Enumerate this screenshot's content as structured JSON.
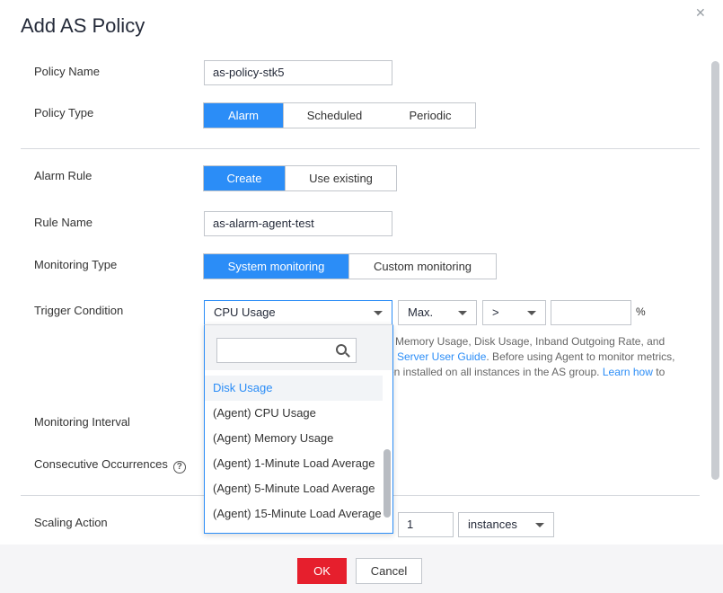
{
  "dialog": {
    "title": "Add AS Policy",
    "close_icon": "close-icon"
  },
  "policy_name": {
    "label": "Policy Name",
    "value": "as-policy-stk5"
  },
  "policy_type": {
    "label": "Policy Type",
    "options": [
      "Alarm",
      "Scheduled",
      "Periodic"
    ],
    "selected": "Alarm"
  },
  "alarm_rule": {
    "label": "Alarm Rule",
    "options": [
      "Create",
      "Use existing"
    ],
    "selected": "Create"
  },
  "rule_name": {
    "label": "Rule Name",
    "value": "as-alarm-agent-test"
  },
  "monitoring_type": {
    "label": "Monitoring Type",
    "options": [
      "System monitoring",
      "Custom monitoring"
    ],
    "selected": "System monitoring"
  },
  "trigger_condition": {
    "label": "Trigger Condition",
    "metric": "CPU Usage",
    "aggregation": "Max.",
    "operator": ">",
    "threshold": "",
    "unit": "%",
    "hint_line1": "Memory Usage, Disk Usage, Inband Outgoing Rate, and",
    "hint_line2_link": "d Server User Guide",
    "hint_line2_rest": ". Before using Agent to monitor metrics,",
    "hint_line3": "en installed on all instances in the AS group.",
    "hint_line3_link": "Learn how",
    "hint_line3_tail": "to"
  },
  "metric_dropdown": {
    "search_placeholder": "",
    "items": [
      "Disk Usage",
      "(Agent) CPU Usage",
      "(Agent) Memory Usage",
      "(Agent) 1-Minute Load Average",
      "(Agent) 5-Minute Load Average",
      "(Agent) 15-Minute Load Average"
    ],
    "selected": "Disk Usage"
  },
  "monitoring_interval": {
    "label": "Monitoring Interval"
  },
  "consecutive_occurrences": {
    "label": "Consecutive Occurrences",
    "help_icon": "question-circle-icon"
  },
  "scaling_action": {
    "label": "Scaling Action",
    "count": "1",
    "unit": "instances"
  },
  "footer": {
    "ok_label": "OK",
    "cancel_label": "Cancel"
  },
  "colors": {
    "accent": "#2b8df7",
    "ok": "#e61f2d"
  }
}
